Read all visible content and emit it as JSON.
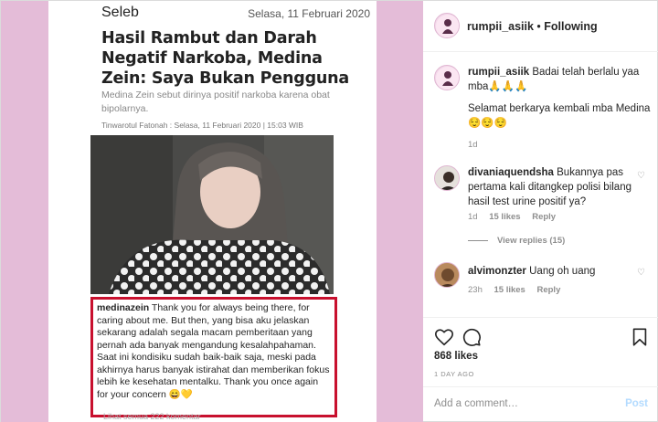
{
  "article": {
    "category": "Seleb",
    "date": "Selasa, 11 Februari 2020",
    "title": "Hasil Rambut dan Darah Negatif Narkoba, Medina Zein: Saya Bukan Pengguna",
    "summary": "Medina Zein sebut dirinya positif narkoba karena obat bipolarnya.",
    "byline": "Tinwarotul Fatonah : Selasa, 11 Februari 2020 | 15:03 WIB",
    "quote_user": "medinazein",
    "quote_text": "Thank you for always being there, for caring about me. But then, yang bisa aku jelaskan sekarang adalah segala macam pemberitaan yang pernah ada banyak mengandung kesalahpahaman. Saat ini kondisiku sudah baik-baik saja, meski pada akhirnya harus banyak istirahat dan memberikan fokus lebih ke kesehatan mentalku. Thank you once again for your concern 😄💛",
    "cut_text": "Lihat semua 222 komentar"
  },
  "header": {
    "username": "rumpii_asiik",
    "separator": " • ",
    "follow_status": "Following"
  },
  "caption": {
    "username": "rumpii_asiik",
    "text": "Badai telah berlalu yaa mba🙏🙏🙏",
    "text2": "Selamat berkarya kembali mba Medina 😌😌😌",
    "time": "1d"
  },
  "comments": [
    {
      "username": "divaniaquendsha",
      "text": "Bukannya pas pertama kali ditangkep polisi bilang hasil test urine positif ya?",
      "time": "1d",
      "likes": "15 likes",
      "reply": "Reply",
      "view_replies": "View replies (15)"
    },
    {
      "username": "alvimonzter",
      "text": "Uang oh uang",
      "time": "23h",
      "likes": "15 likes",
      "reply": "Reply"
    }
  ],
  "actions": {
    "likes": "868 likes",
    "time_ago": "1 DAY AGO"
  },
  "add_comment": {
    "placeholder": "Add a comment…",
    "post_label": "Post"
  },
  "colors": {
    "background_pink": "#e4bcd8",
    "highlight_red": "#c8102e",
    "post_blue": "#b3dbff"
  },
  "icons": {
    "like": "heart-icon",
    "comment": "comment-icon",
    "save": "bookmark-icon"
  }
}
